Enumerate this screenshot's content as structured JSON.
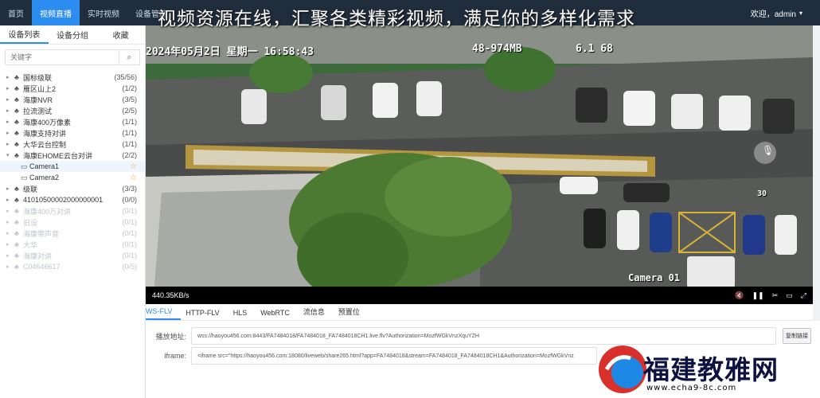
{
  "banner": "视频资源在线，汇聚各类精彩视频，满足你的多样化需求",
  "nav": {
    "items": [
      "首页",
      "视频直播",
      "实时视频",
      "设备管理"
    ],
    "active_index": 1,
    "welcome": "欢迎，admin"
  },
  "sidebar": {
    "tabs": [
      "设备列表",
      "设备分组",
      "收藏"
    ],
    "search_placeholder": "关键字",
    "tree": [
      {
        "label": "国标级联",
        "count": "(35/56)"
      },
      {
        "label": "雁区山上2",
        "count": "(1/2)"
      },
      {
        "label": "海康NVR",
        "count": "(3/5)"
      },
      {
        "label": "拉流测试",
        "count": "(2/5)"
      },
      {
        "label": "海康400万像素",
        "count": "(1/1)"
      },
      {
        "label": "海康支持对讲",
        "count": "(1/1)"
      },
      {
        "label": "大华云台控制",
        "count": "(1/1)"
      },
      {
        "label": "海康EHOME云台对讲",
        "count": "(2/2)"
      },
      {
        "label": "Camera1",
        "count": ""
      },
      {
        "label": "Camera2",
        "count": ""
      },
      {
        "label": "级联",
        "count": "(3/3)"
      },
      {
        "label": "41010500002000000001",
        "count": "(0/0)"
      },
      {
        "label": "海康400万对讲",
        "count": "(0/1)"
      },
      {
        "label": "旧设",
        "count": "(0/1)"
      },
      {
        "label": "海康带声音",
        "count": "(0/1)"
      },
      {
        "label": "大华",
        "count": "(0/1)"
      },
      {
        "label": "海康对讲",
        "count": "(0/1)"
      },
      {
        "label": "C04646617",
        "count": "(0/5)"
      }
    ]
  },
  "video": {
    "osd_datetime": "2024年05月2日 星期一 16:58:43",
    "osd_stats": "48-974MB",
    "osd_extra": "6.1 68",
    "camera_label": "Camera 01",
    "number_30": "30",
    "bitrate": "440.35KB/s"
  },
  "stream": {
    "tabs": [
      "WS-FLV",
      "HTTP-FLV",
      "HLS",
      "WebRTC",
      "流信息",
      "预置位"
    ],
    "active_index": 0,
    "play_label": "播放地址:",
    "play_url": "wss://haoyou456.com:8443/FA7484018/FA7484018_FA7484018CH1.live.flv?Authorization=MozfWGkVnzXquYZH",
    "iframe_label": "iframe:",
    "iframe_code": "<iframe src=\"https://haoyou456.com:18080/liveweb/share265.html?app=FA7484018&stream=FA7484018_FA7484018CH1&Authorization=MozfWGkVnz",
    "copy_label": "复制链接"
  },
  "watermark": {
    "text": "福建教雅网",
    "url": "www.echa9-8c.com"
  },
  "colors": {
    "nav_bg": "#1f2d3d",
    "accent": "#2d8cf0"
  }
}
